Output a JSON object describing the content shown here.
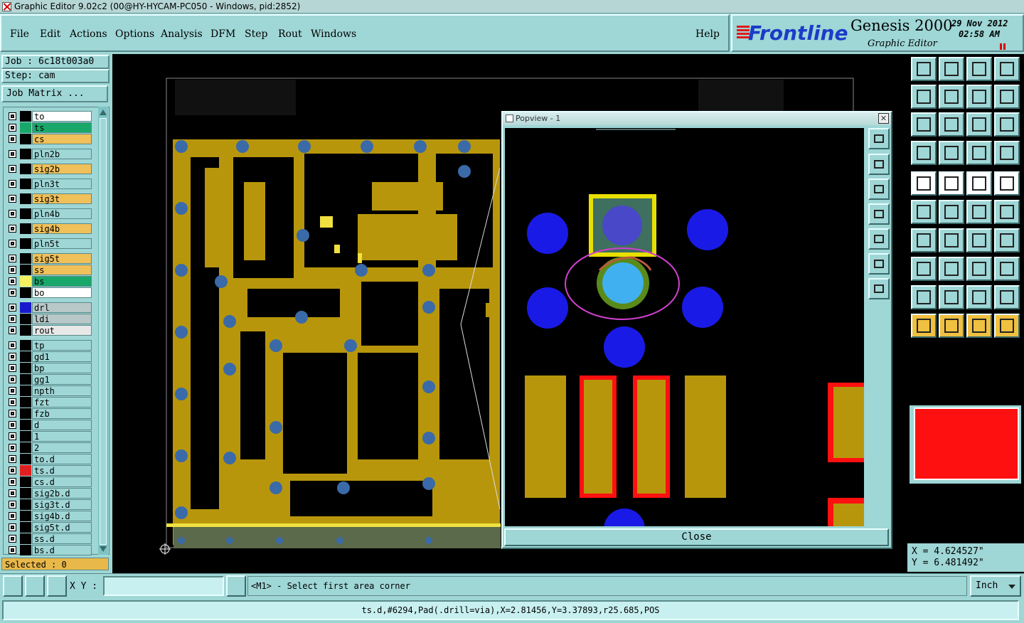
{
  "window": {
    "title": "Graphic Editor 9.02c2 (00@HY-HYCAM-PC050 - Windows, pid:2852)"
  },
  "menu": [
    {
      "label": "File"
    },
    {
      "label": "Edit"
    },
    {
      "label": "Actions"
    },
    {
      "label": "Options"
    },
    {
      "label": "Analysis"
    },
    {
      "label": "DFM"
    },
    {
      "label": "Step"
    },
    {
      "label": "Rout"
    },
    {
      "label": "Windows"
    }
  ],
  "help_label": "Help",
  "branding": {
    "logo": "Frontline",
    "product": "Genesis 2000",
    "subtitle": "Graphic Editor",
    "date": "29 Nov 2012",
    "time": "02:58 AM"
  },
  "job": {
    "job_text": "Job : 6c18t003a0",
    "step_text": "Step: cam",
    "matrix_button": "Job Matrix ..."
  },
  "layers": [
    {
      "name": "to",
      "color": "#ffffff",
      "swatch": "#000000"
    },
    {
      "name": "ts",
      "color": "#1aa86a",
      "swatch": "#1aa86a"
    },
    {
      "name": "cs",
      "color": "#f0c05a",
      "swatch": "#000000"
    },
    {
      "name": "pln2b",
      "color": "#9fd6d6",
      "swatch": "#000000"
    },
    {
      "name": "sig2b",
      "color": "#f0c05a",
      "swatch": "#000000"
    },
    {
      "name": "pln3t",
      "color": "#9fd6d6",
      "swatch": "#000000"
    },
    {
      "name": "sig3t",
      "color": "#f0c05a",
      "swatch": "#000000"
    },
    {
      "name": "pln4b",
      "color": "#9fd6d6",
      "swatch": "#000000"
    },
    {
      "name": "sig4b",
      "color": "#f0c05a",
      "swatch": "#000000"
    },
    {
      "name": "pln5t",
      "color": "#9fd6d6",
      "swatch": "#000000"
    },
    {
      "name": "sig5t",
      "color": "#f0c05a",
      "swatch": "#000000"
    },
    {
      "name": "ss",
      "color": "#f0c05a",
      "swatch": "#000000"
    },
    {
      "name": "bs",
      "color": "#1aa86a",
      "swatch": "#f5f060"
    },
    {
      "name": "bo",
      "color": "#ffffff",
      "swatch": "#000000"
    },
    {
      "name": "drl",
      "color": "#b8c8c8",
      "swatch": "#1a1acc"
    },
    {
      "name": "ldi",
      "color": "#b8c8c8",
      "swatch": "#000000"
    },
    {
      "name": "rout",
      "color": "#e8e8e8",
      "swatch": "#000000"
    },
    {
      "name": "tp",
      "color": "#9fd6d6",
      "swatch": "#000000"
    },
    {
      "name": "gd1",
      "color": "#9fd6d6",
      "swatch": "#000000"
    },
    {
      "name": "bp",
      "color": "#9fd6d6",
      "swatch": "#000000"
    },
    {
      "name": "gg1",
      "color": "#9fd6d6",
      "swatch": "#000000"
    },
    {
      "name": "npth",
      "color": "#9fd6d6",
      "swatch": "#000000"
    },
    {
      "name": "fzt",
      "color": "#9fd6d6",
      "swatch": "#000000"
    },
    {
      "name": "fzb",
      "color": "#9fd6d6",
      "swatch": "#000000"
    },
    {
      "name": "d",
      "color": "#9fd6d6",
      "swatch": "#000000"
    },
    {
      "name": "1",
      "color": "#9fd6d6",
      "swatch": "#000000"
    },
    {
      "name": "2",
      "color": "#9fd6d6",
      "swatch": "#000000"
    },
    {
      "name": "to.d",
      "color": "#9fd6d6",
      "swatch": "#000000"
    },
    {
      "name": "ts.d",
      "color": "#9fd6d6",
      "swatch": "#e02020"
    },
    {
      "name": "cs.d",
      "color": "#9fd6d6",
      "swatch": "#000000"
    },
    {
      "name": "sig2b.d",
      "color": "#9fd6d6",
      "swatch": "#000000"
    },
    {
      "name": "sig3t.d",
      "color": "#9fd6d6",
      "swatch": "#000000"
    },
    {
      "name": "sig4b.d",
      "color": "#9fd6d6",
      "swatch": "#000000"
    },
    {
      "name": "sig5t.d",
      "color": "#9fd6d6",
      "swatch": "#000000"
    },
    {
      "name": "ss.d",
      "color": "#9fd6d6",
      "swatch": "#000000"
    },
    {
      "name": "bs.d",
      "color": "#9fd6d6",
      "swatch": "#000000"
    }
  ],
  "selected_text": "Selected : 0",
  "popview": {
    "title": "Popview - 1",
    "close_label": "Close"
  },
  "coords": {
    "x_text": "X = 4.624527\"",
    "y_text": "Y = 6.481492\""
  },
  "bottom": {
    "xy_label": "X Y :",
    "xy_value": "",
    "prompt": "<M1> - Select first area corner",
    "units": "Inch"
  },
  "status_text": "ts.d,#6294,Pad(.drill=via),X=2.81456,Y=3.37893,r25.685,POS",
  "colors": {
    "panel": "#9fd6d6",
    "canvas": "#000000",
    "copper": "#b8960c",
    "via": "#1a1ae6",
    "highlight_red": "#ff1010"
  }
}
